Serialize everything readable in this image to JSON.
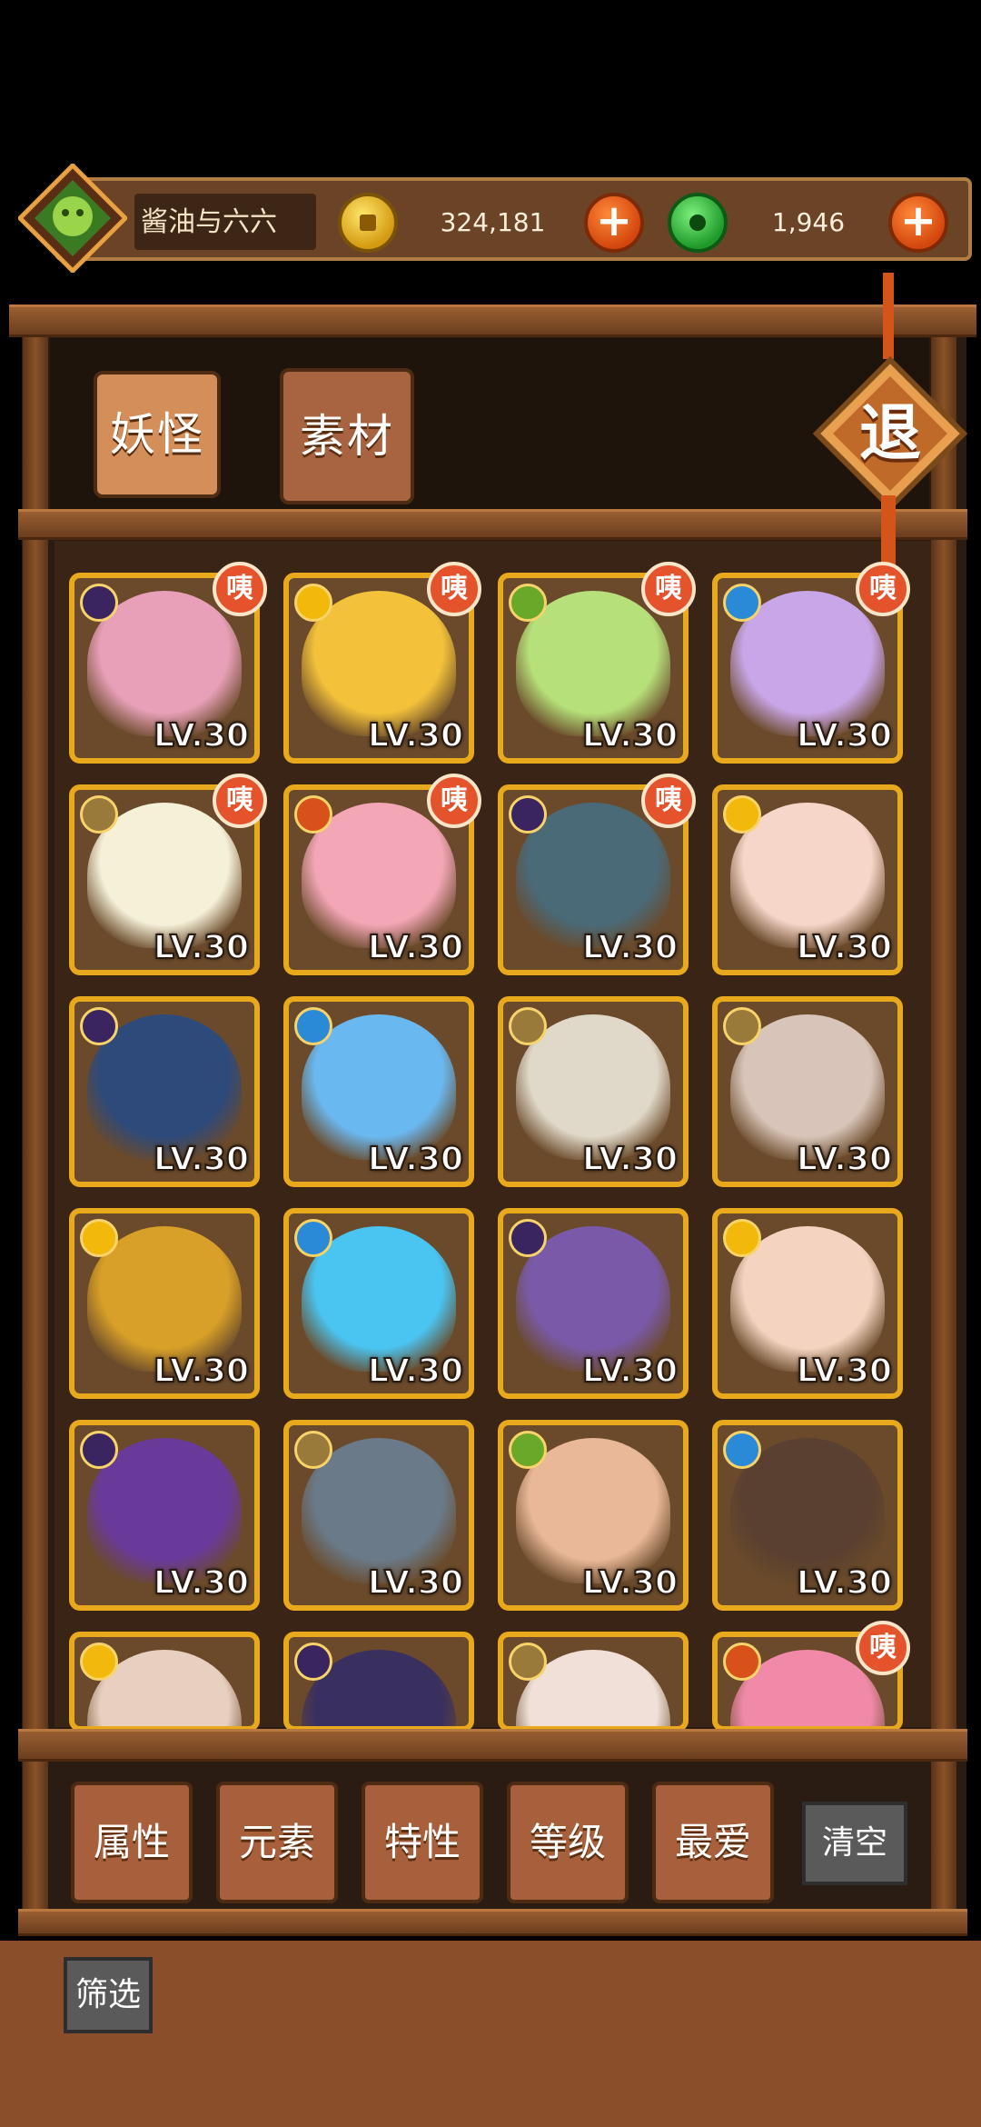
{
  "header": {
    "player_name": "酱油与六六",
    "gold_amount": "324,181",
    "jade_amount": "1,946",
    "plus_symbol": "+"
  },
  "tabs": [
    {
      "label": "妖怪",
      "selected": true
    },
    {
      "label": "素材",
      "selected": false
    }
  ],
  "retreat_label": "退",
  "badge_text": "咦",
  "cards": [
    {
      "level": "LV.30",
      "element": "moon",
      "new": true,
      "color": "#e8a0b8"
    },
    {
      "level": "LV.30",
      "element": "sun",
      "new": true,
      "color": "#f4c23a"
    },
    {
      "level": "LV.30",
      "element": "leaf",
      "new": true,
      "color": "#b6e07a"
    },
    {
      "level": "LV.30",
      "element": "water",
      "new": true,
      "color": "#c9a6e8"
    },
    {
      "level": "LV.30",
      "element": "earth",
      "new": true,
      "color": "#f5f0d8"
    },
    {
      "level": "LV.30",
      "element": "fire",
      "new": true,
      "color": "#f3a6b6"
    },
    {
      "level": "LV.30",
      "element": "moon",
      "new": true,
      "color": "#4a6a78"
    },
    {
      "level": "LV.30",
      "element": "sun",
      "new": false,
      "color": "#f6d6c8"
    },
    {
      "level": "LV.30",
      "element": "moon",
      "new": false,
      "color": "#2e4a7a"
    },
    {
      "level": "LV.30",
      "element": "water",
      "new": false,
      "color": "#6ab8f0"
    },
    {
      "level": "LV.30",
      "element": "earth",
      "new": false,
      "color": "#e0d8c8"
    },
    {
      "level": "LV.30",
      "element": "earth",
      "new": false,
      "color": "#d8c4b8"
    },
    {
      "level": "LV.30",
      "element": "sun",
      "new": false,
      "color": "#d8a028"
    },
    {
      "level": "LV.30",
      "element": "water",
      "new": false,
      "color": "#4ac4f0"
    },
    {
      "level": "LV.30",
      "element": "moon",
      "new": false,
      "color": "#7a5aa8"
    },
    {
      "level": "LV.30",
      "element": "sun",
      "new": false,
      "color": "#f4d4c0"
    },
    {
      "level": "LV.30",
      "element": "moon",
      "new": false,
      "color": "#6a3a9a"
    },
    {
      "level": "LV.30",
      "element": "earth",
      "new": false,
      "color": "#6a7a88"
    },
    {
      "level": "LV.30",
      "element": "leaf",
      "new": false,
      "color": "#e8b898"
    },
    {
      "level": "LV.30",
      "element": "water",
      "new": false,
      "color": "#5a4030"
    },
    {
      "level": "",
      "element": "sun",
      "new": false,
      "color": "#e8d0c0"
    },
    {
      "level": "",
      "element": "moon",
      "new": false,
      "color": "#3a3060"
    },
    {
      "level": "",
      "element": "earth",
      "new": false,
      "color": "#f0e0d8"
    },
    {
      "level": "",
      "element": "fire",
      "new": true,
      "color": "#f08aa8"
    }
  ],
  "element_colors": {
    "moon": "#3a2560",
    "sun": "#f2b90c",
    "leaf": "#6aa82a",
    "water": "#2a8ad8",
    "earth": "#9a7a3a",
    "fire": "#d8501a"
  },
  "filters": [
    {
      "label": "属性"
    },
    {
      "label": "元素"
    },
    {
      "label": "特性"
    },
    {
      "label": "等级"
    },
    {
      "label": "最爱"
    }
  ],
  "clear_label": "清空",
  "filter_label": "筛选"
}
